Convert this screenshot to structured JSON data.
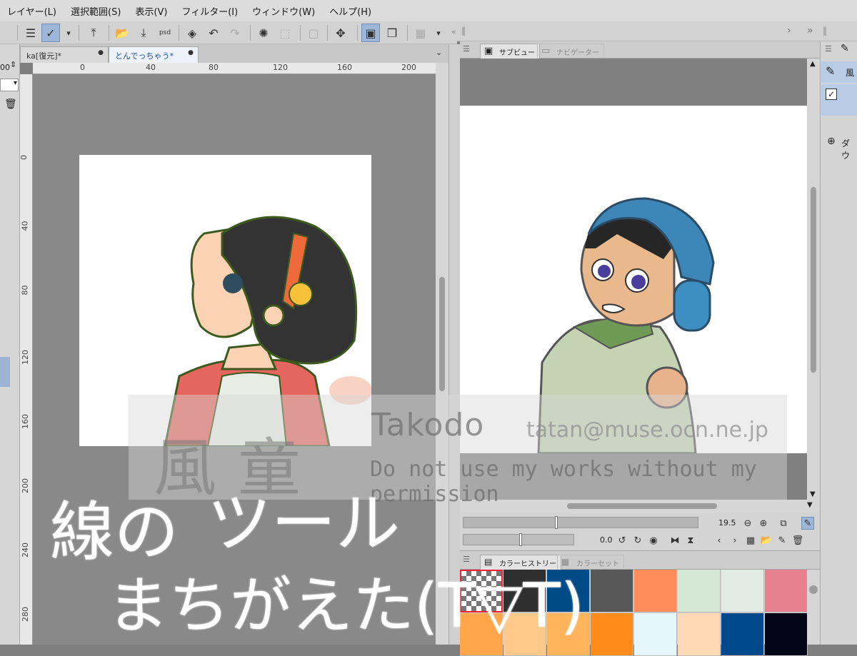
{
  "menu": [
    "レイヤー(L)",
    "選択範囲(S)",
    "表示(V)",
    "フィルター(I)",
    "ウィンドウ(W)",
    "ヘルプ(H)"
  ],
  "docs": [
    {
      "label": "ka[復元]*",
      "close": "●"
    },
    {
      "label": "とんでっちゃう*",
      "close": "●"
    }
  ],
  "ruler": {
    "h": [
      "0",
      "40",
      "80",
      "120",
      "160",
      "200"
    ],
    "v": [
      "0",
      "40",
      "80",
      "120",
      "160",
      "200",
      "240",
      "280"
    ]
  },
  "left": {
    "value": "00"
  },
  "subview": {
    "tab_subview": "サブビュー",
    "tab_navigator": "ナビゲーター",
    "zoom": "19.5",
    "rotation": "0.0"
  },
  "color": {
    "tab_history": "カラーヒストリー",
    "tab_set": "カラーセット",
    "swatches": [
      "transparent",
      "#2f2f2f",
      "#004b87",
      "#585858",
      "#ff8c5a",
      "#d4e8d4",
      "#e4eae4",
      "#e8818f",
      "#ffa64d",
      "#ffc98a",
      "#ffb35a",
      "#ff8c1a",
      "#e6f7fb",
      "#ffd9b3",
      "#004a8c",
      "#050518"
    ]
  },
  "layers": {
    "item": "風",
    "add_label": "ダウ"
  },
  "watermark": {
    "kanji": "風童",
    "title": "Takodo",
    "email": "tatan@muse.ocn.ne.jp",
    "note": "Do not use my works without my permission"
  },
  "handwriting": {
    "line1": "線の",
    "line2": "ツール",
    "line3": "まちがえた(T▽T)"
  }
}
